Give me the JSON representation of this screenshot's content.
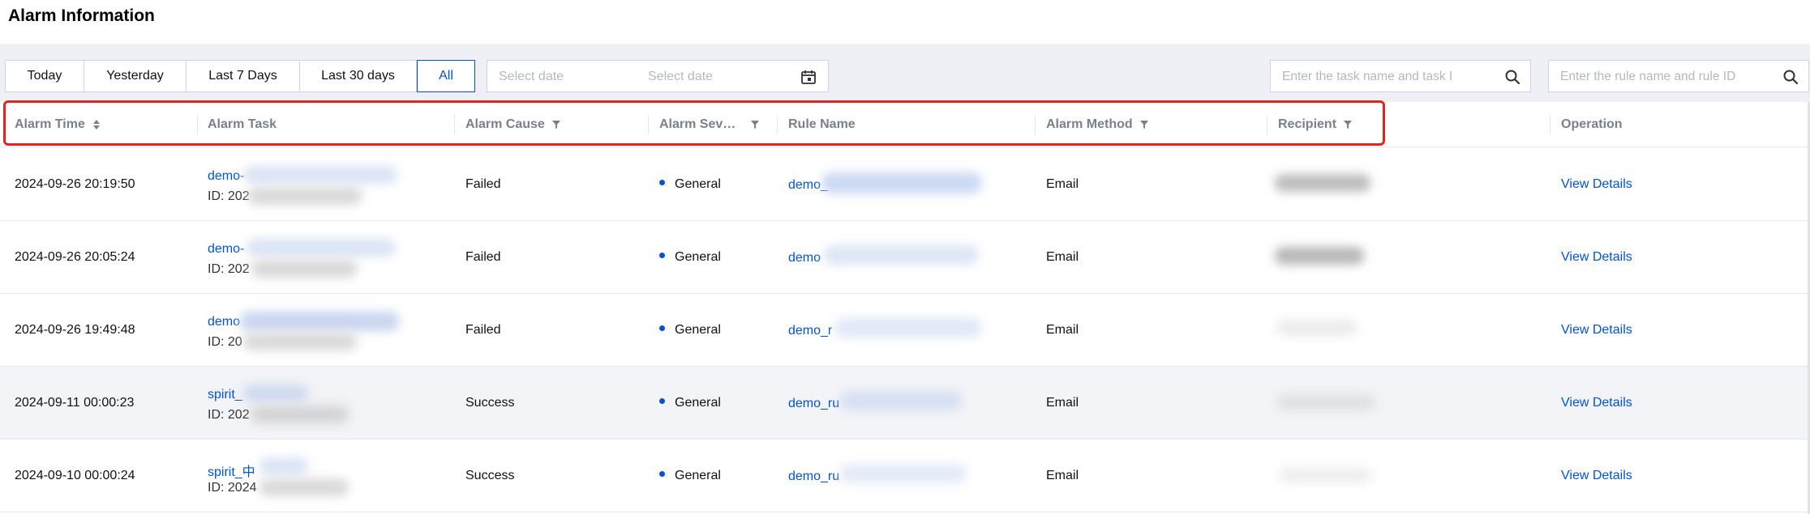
{
  "page": {
    "title": "Alarm Information"
  },
  "filters": {
    "segments": [
      {
        "label": "Today",
        "active": false
      },
      {
        "label": "Yesterday",
        "active": false
      },
      {
        "label": "Last 7 Days",
        "active": false
      },
      {
        "label": "Last 30 days",
        "active": false
      },
      {
        "label": "All",
        "active": true
      }
    ],
    "start_date_placeholder": "Select date",
    "end_date_placeholder": "Select date",
    "task_search_placeholder": "Enter the task name and task I",
    "rule_search_placeholder": "Enter the rule name and rule ID"
  },
  "table": {
    "columns": {
      "alarm_time": "Alarm Time",
      "alarm_task": "Alarm Task",
      "alarm_cause": "Alarm Cause",
      "alarm_severity": "Alarm Sev…",
      "rule_name": "Rule Name",
      "alarm_method": "Alarm Method",
      "recipient": "Recipient",
      "operation": "Operation"
    },
    "rows": [
      {
        "time": "2024-09-26 20:19:50",
        "task_name": "demo-",
        "task_id": "ID: 202",
        "cause": "Failed",
        "severity": "General",
        "rule": "demo_",
        "method": "Email",
        "operation": "View Details"
      },
      {
        "time": "2024-09-26 20:05:24",
        "task_name": "demo-",
        "task_id": "ID: 202",
        "cause": "Failed",
        "severity": "General",
        "rule": "demo",
        "method": "Email",
        "operation": "View Details"
      },
      {
        "time": "2024-09-26 19:49:48",
        "task_name": "demo",
        "task_id": "ID: 20",
        "cause": "Failed",
        "severity": "General",
        "rule": "demo_r",
        "method": "Email",
        "operation": "View Details"
      },
      {
        "time": "2024-09-11 00:00:23",
        "task_name": "spirit_",
        "task_id": "ID: 202",
        "cause": "Success",
        "severity": "General",
        "rule": "demo_ru",
        "method": "Email",
        "operation": "View Details"
      },
      {
        "time": "2024-09-10 00:00:24",
        "task_name": "spirit_中",
        "task_id": "ID: 2024",
        "cause": "Success",
        "severity": "General",
        "rule": "demo_ru",
        "method": "Email",
        "operation": "View Details"
      }
    ]
  },
  "colors": {
    "accent": "#0052d9",
    "highlight": "#e5251b",
    "band": "#eef0f5"
  },
  "icons": [
    "calendar-icon",
    "search-icon",
    "sort-icon",
    "filter-icon"
  ]
}
